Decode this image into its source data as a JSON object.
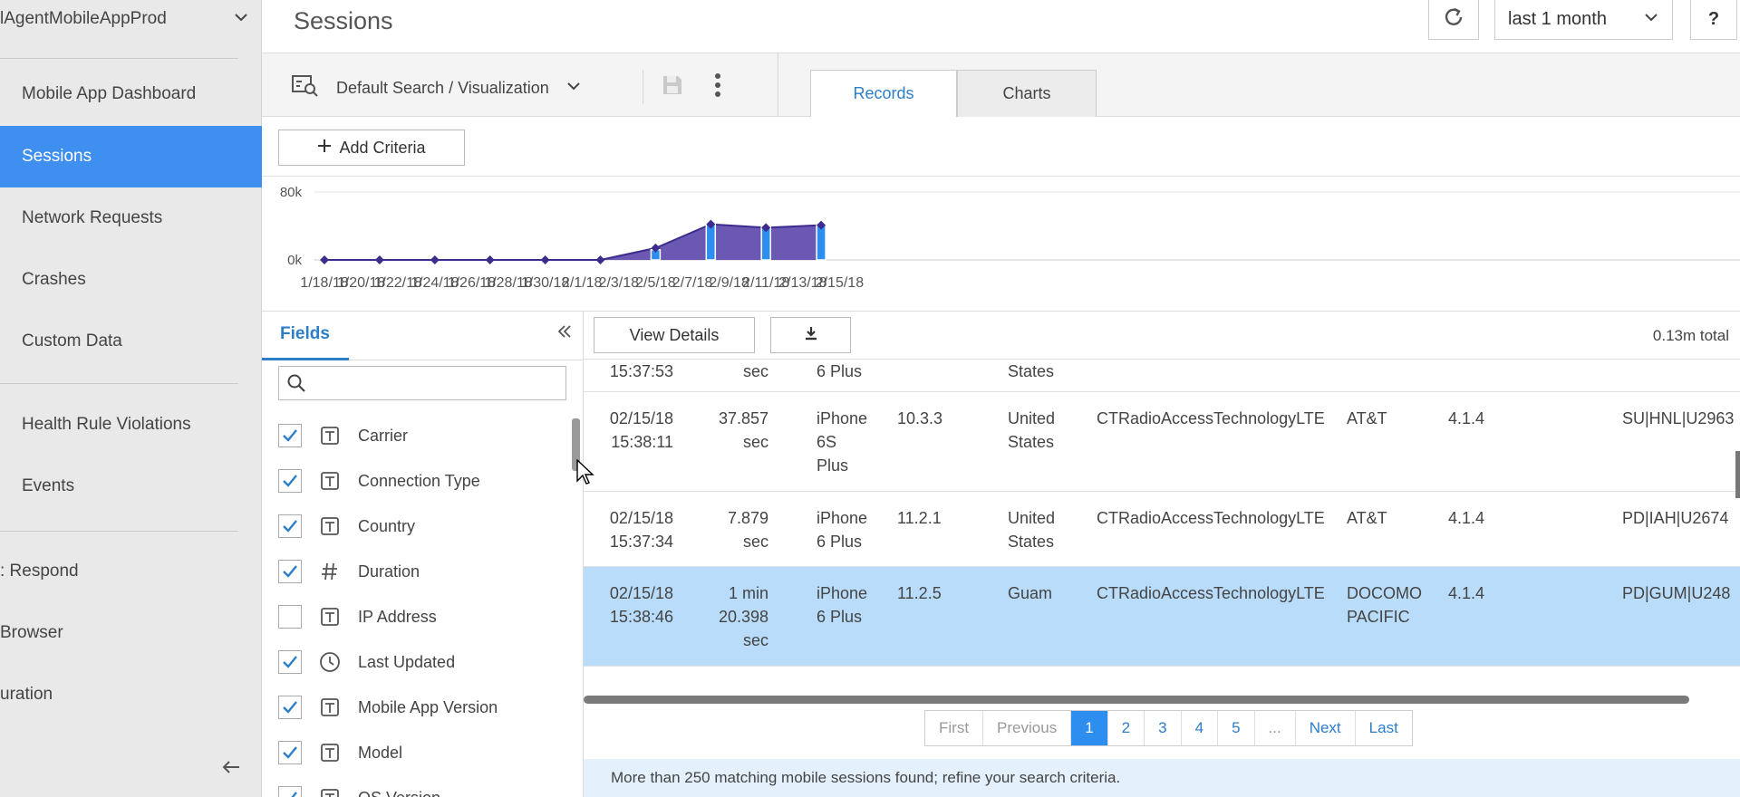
{
  "sidebar": {
    "app_name": "lAgentMobileAppProd",
    "items": [
      {
        "label": "Mobile App Dashboard"
      },
      {
        "label": "Sessions"
      },
      {
        "label": "Network Requests"
      },
      {
        "label": "Crashes"
      },
      {
        "label": "Custom Data"
      },
      {
        "label": "Health Rule Violations"
      },
      {
        "label": "Events"
      },
      {
        "label": ": Respond"
      },
      {
        "label": "Browser"
      },
      {
        "label": "uration"
      }
    ]
  },
  "header": {
    "title": "Sessions",
    "time_range": "last 1 month",
    "help_label": "?"
  },
  "toolbar": {
    "search_label": "Default Search / Visualization",
    "tabs": [
      {
        "label": "Records"
      },
      {
        "label": "Charts"
      }
    ]
  },
  "criteria": {
    "add_label": "Add Criteria"
  },
  "chart_data": {
    "type": "area",
    "y_tick_labels": [
      "80k",
      "0k"
    ],
    "ylim": [
      0,
      80000
    ],
    "x_tick_labels": [
      "1/18/18",
      "1/20/18",
      "1/22/18",
      "1/24/18",
      "1/26/18",
      "1/28/18",
      "1/30/18",
      "2/1/18",
      "2/3/18",
      "2/5/18",
      "2/7/18",
      "2/9/18",
      "2/11/18",
      "2/13/18",
      "2/15/18"
    ],
    "series": [
      {
        "x": [
          "1/18/18",
          "1/21/18",
          "1/24/18",
          "1/27/18",
          "1/30/18",
          "2/2/18",
          "2/5/18",
          "2/8/18",
          "2/11/18",
          "2/14/18"
        ],
        "values": [
          0,
          0,
          0,
          0,
          0,
          0,
          14000,
          42000,
          38000,
          41000
        ]
      }
    ],
    "bar_markers": [
      {
        "x": "2/5/18",
        "value": 12000
      },
      {
        "x": "2/8/18",
        "value": 42000
      },
      {
        "x": "2/11/18",
        "value": 39000
      },
      {
        "x": "2/14/18",
        "value": 41000
      }
    ],
    "colors": {
      "fill": "#6a58b3",
      "line": "#3d2c8d",
      "marker": "#2d8ef0"
    }
  },
  "fields": {
    "tab_label": "Fields",
    "search_placeholder": "",
    "items": [
      {
        "label": "Carrier",
        "checked": true,
        "type": "text"
      },
      {
        "label": "Connection Type",
        "checked": true,
        "type": "text"
      },
      {
        "label": "Country",
        "checked": true,
        "type": "text"
      },
      {
        "label": "Duration",
        "checked": true,
        "type": "number"
      },
      {
        "label": "IP Address",
        "checked": false,
        "type": "text"
      },
      {
        "label": "Last Updated",
        "checked": true,
        "type": "time"
      },
      {
        "label": "Mobile App Version",
        "checked": true,
        "type": "text"
      },
      {
        "label": "Model",
        "checked": true,
        "type": "text"
      },
      {
        "label": "OS Version",
        "checked": true,
        "type": "text"
      }
    ]
  },
  "records": {
    "view_details_label": "View Details",
    "total": "0.13m total",
    "rows": [
      {
        "time": [
          "15:37:53"
        ],
        "duration": [
          "sec"
        ],
        "model": [
          "6 Plus"
        ],
        "os": "",
        "country": [
          "States"
        ],
        "conn": "",
        "carrier": [],
        "version": "",
        "extra": ""
      },
      {
        "time": [
          "02/15/18",
          "15:38:11"
        ],
        "duration": [
          "37.857",
          "sec"
        ],
        "model": [
          "iPhone",
          "6S",
          "Plus"
        ],
        "os": "10.3.3",
        "country": [
          "United",
          "States"
        ],
        "conn": "CTRadioAccessTechnologyLTE",
        "carrier": [
          "AT&T"
        ],
        "version": "4.1.4",
        "extra": "SU|HNL|U2963"
      },
      {
        "time": [
          "02/15/18",
          "15:37:34"
        ],
        "duration": [
          "7.879",
          "sec"
        ],
        "model": [
          "iPhone",
          "6 Plus"
        ],
        "os": "11.2.1",
        "country": [
          "United",
          "States"
        ],
        "conn": "CTRadioAccessTechnologyLTE",
        "carrier": [
          "AT&T"
        ],
        "version": "4.1.4",
        "extra": "PD|IAH|U2674"
      },
      {
        "time": [
          "02/15/18",
          "15:38:46"
        ],
        "duration": [
          "1 min",
          "20.398",
          "sec"
        ],
        "model": [
          "iPhone",
          "6 Plus"
        ],
        "os": "11.2.5",
        "country": [
          "Guam"
        ],
        "conn": "CTRadioAccessTechnologyLTE",
        "carrier": [
          "DOCOMO",
          "PACIFIC"
        ],
        "version": "4.1.4",
        "extra": "PD|GUM|U248"
      }
    ]
  },
  "pagination": {
    "first": "First",
    "previous": "Previous",
    "pages": [
      "1",
      "2",
      "3",
      "4",
      "5",
      "..."
    ],
    "next": "Next",
    "last": "Last",
    "current": "1"
  },
  "notice": "More than 250 matching mobile sessions found; refine your search criteria."
}
